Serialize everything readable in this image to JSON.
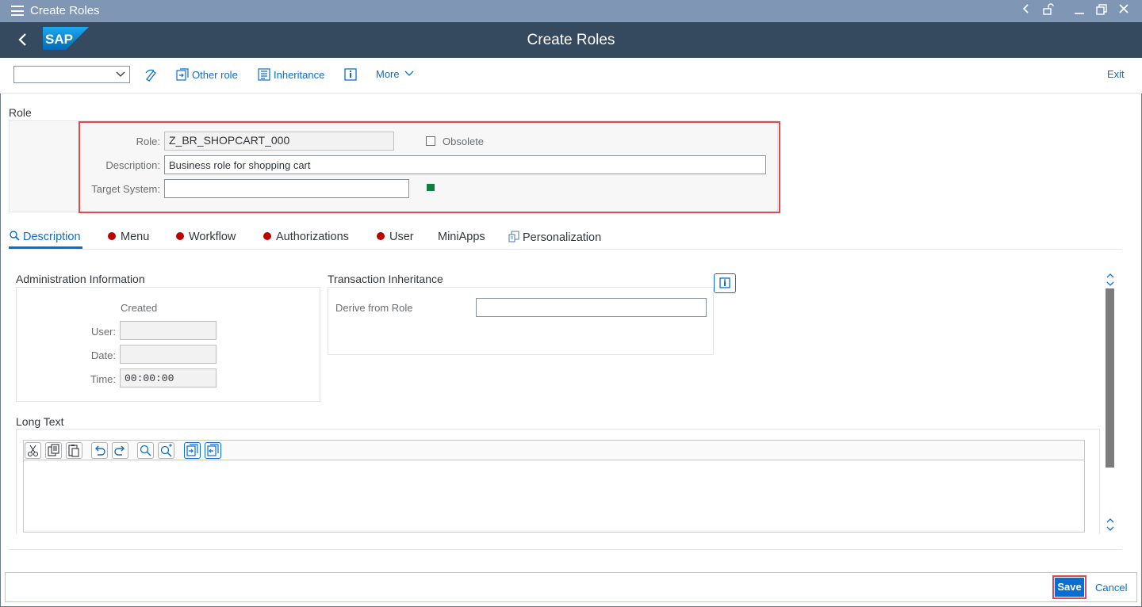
{
  "window": {
    "title": "Create Roles"
  },
  "shell": {
    "logo_text": "SAP",
    "heading": "Create Roles"
  },
  "toolbar": {
    "dropdown_value": "",
    "other_role": "Other role",
    "inheritance": "Inheritance",
    "more": "More",
    "exit": "Exit"
  },
  "role_section": {
    "title": "Role",
    "role_label": "Role:",
    "role_value": "Z_BR_SHOPCART_000",
    "obsolete_label": "Obsolete",
    "description_label": "Description:",
    "description_value": "Business role for shopping cart",
    "target_system_label": "Target System:",
    "target_system_value": "",
    "status_color": "#107e3e"
  },
  "tabs": [
    {
      "label": "Description",
      "active": true,
      "icon": "magnifier-icon"
    },
    {
      "label": "Menu",
      "status": "red"
    },
    {
      "label": "Workflow",
      "status": "red"
    },
    {
      "label": "Authorizations",
      "status": "red"
    },
    {
      "label": "User",
      "status": "red"
    },
    {
      "label": "MiniApps"
    },
    {
      "label": "Personalization",
      "icon": "personalization-icon"
    }
  ],
  "admin": {
    "title": "Administration Information",
    "created_label": "Created",
    "user_label": "User:",
    "user_value": "",
    "date_label": "Date:",
    "date_value": "",
    "time_label": "Time:",
    "time_value": "00:00:00"
  },
  "inheritance": {
    "title": "Transaction Inheritance",
    "derive_label": "Derive from Role",
    "derive_value": ""
  },
  "long_text": {
    "title": "Long Text",
    "tools": [
      "cut-icon",
      "copy-icon",
      "paste-icon",
      "undo-icon",
      "redo-icon",
      "search-icon",
      "search-next-icon",
      "import-icon",
      "export-icon"
    ]
  },
  "footer": {
    "save": "Save",
    "cancel": "Cancel"
  },
  "colors": {
    "accent": "#0a6ed1",
    "shell": "#354a5f",
    "titlebar": "#7f97b5",
    "error": "#bb0000",
    "highlight": "#e24a4a"
  }
}
